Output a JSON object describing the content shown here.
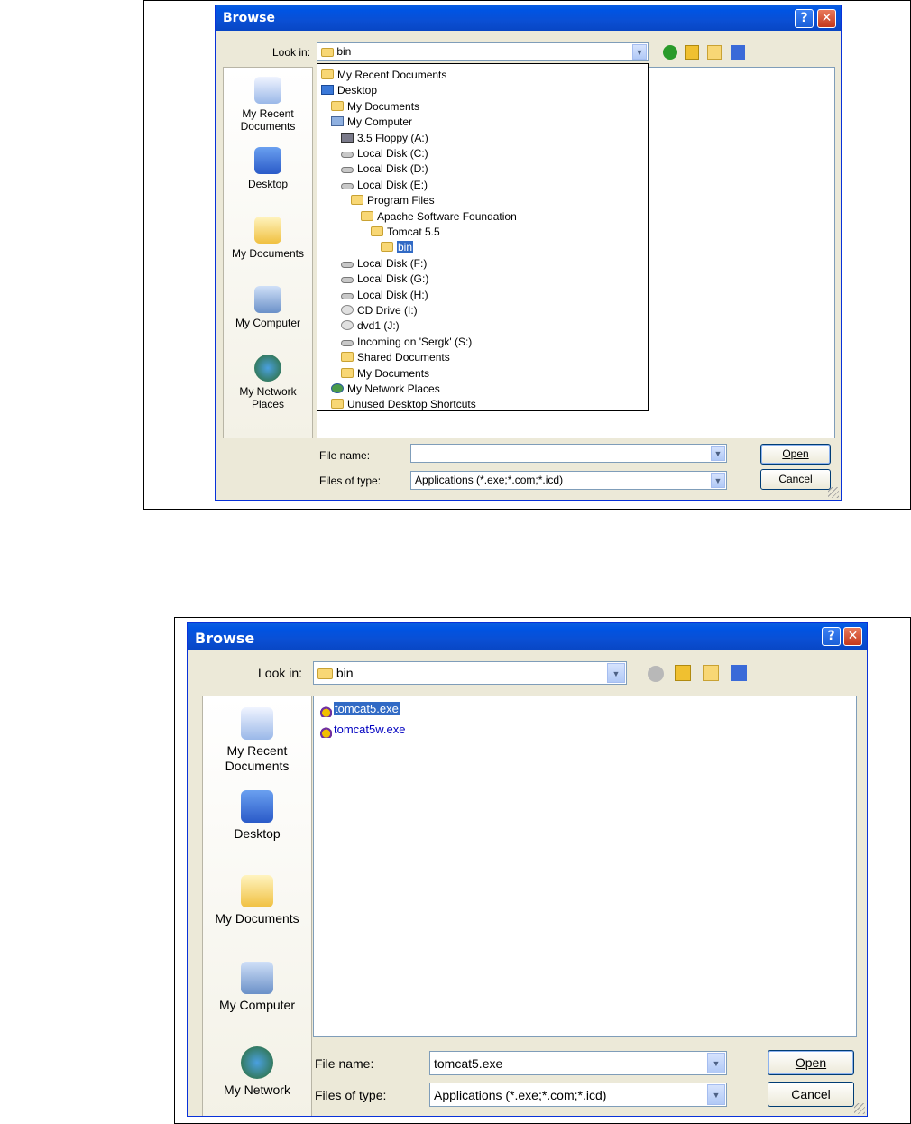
{
  "dialog1": {
    "title": "Browse",
    "look_in_label": "Look in:",
    "look_in_value": "bin",
    "places": [
      "My Recent Documents",
      "Desktop",
      "My Documents",
      "My Computer",
      "My Network Places"
    ],
    "dropdown_items": [
      {
        "label": "My Recent Documents",
        "icon": "recent-docs-icon",
        "level": 0
      },
      {
        "label": "Desktop",
        "icon": "desktop-icon",
        "level": 0
      },
      {
        "label": "My Documents",
        "icon": "my-documents-icon",
        "level": 1
      },
      {
        "label": "My Computer",
        "icon": "my-computer-icon",
        "level": 1
      },
      {
        "label": "3.5 Floppy (A:)",
        "icon": "floppy-icon",
        "level": 2
      },
      {
        "label": "Local Disk (C:)",
        "icon": "drive-icon",
        "level": 2
      },
      {
        "label": "Local Disk (D:)",
        "icon": "drive-icon",
        "level": 2
      },
      {
        "label": "Local Disk (E:)",
        "icon": "drive-icon",
        "level": 2
      },
      {
        "label": "Program Files",
        "icon": "folder-icon",
        "level": 3
      },
      {
        "label": "Apache Software Foundation",
        "icon": "folder-icon",
        "level": 4
      },
      {
        "label": "Tomcat 5.5",
        "icon": "folder-icon",
        "level": 5
      },
      {
        "label": "bin",
        "icon": "folder-icon",
        "level": 6,
        "selected": true
      },
      {
        "label": "Local Disk (F:)",
        "icon": "drive-icon",
        "level": 2
      },
      {
        "label": "Local Disk (G:)",
        "icon": "drive-icon",
        "level": 2
      },
      {
        "label": "Local Disk (H:)",
        "icon": "drive-icon",
        "level": 2
      },
      {
        "label": "CD Drive (I:)",
        "icon": "cd-drive-icon",
        "level": 2
      },
      {
        "label": "dvd1 (J:)",
        "icon": "cd-drive-icon",
        "level": 2
      },
      {
        "label": "Incoming on 'Sergk' (S:)",
        "icon": "network-drive-icon",
        "level": 2
      },
      {
        "label": "Shared Documents",
        "icon": "folder-icon",
        "level": 2
      },
      {
        "label": "My Documents",
        "icon": "folder-icon",
        "level": 2
      },
      {
        "label": "My Network Places",
        "icon": "network-places-icon",
        "level": 1
      },
      {
        "label": "Unused Desktop Shortcuts",
        "icon": "folder-icon",
        "level": 1
      }
    ],
    "file_name_label": "File name:",
    "file_name_value": "",
    "files_of_type_label": "Files of type:",
    "files_of_type_value": "Applications (*.exe;*.com;*.icd)",
    "open_label": "Open",
    "cancel_label": "Cancel"
  },
  "dialog2": {
    "title": "Browse",
    "look_in_label": "Look in:",
    "look_in_value": "bin",
    "places": [
      "My Recent Documents",
      "Desktop",
      "My Documents",
      "My Computer",
      "My Network"
    ],
    "files": [
      {
        "name": "tomcat5.exe",
        "selected": true
      },
      {
        "name": "tomcat5w.exe",
        "selected": false
      }
    ],
    "file_name_label": "File name:",
    "file_name_value": "tomcat5.exe",
    "files_of_type_label": "Files of type:",
    "files_of_type_value": "Applications (*.exe;*.com;*.icd)",
    "open_label": "Open",
    "cancel_label": "Cancel"
  }
}
